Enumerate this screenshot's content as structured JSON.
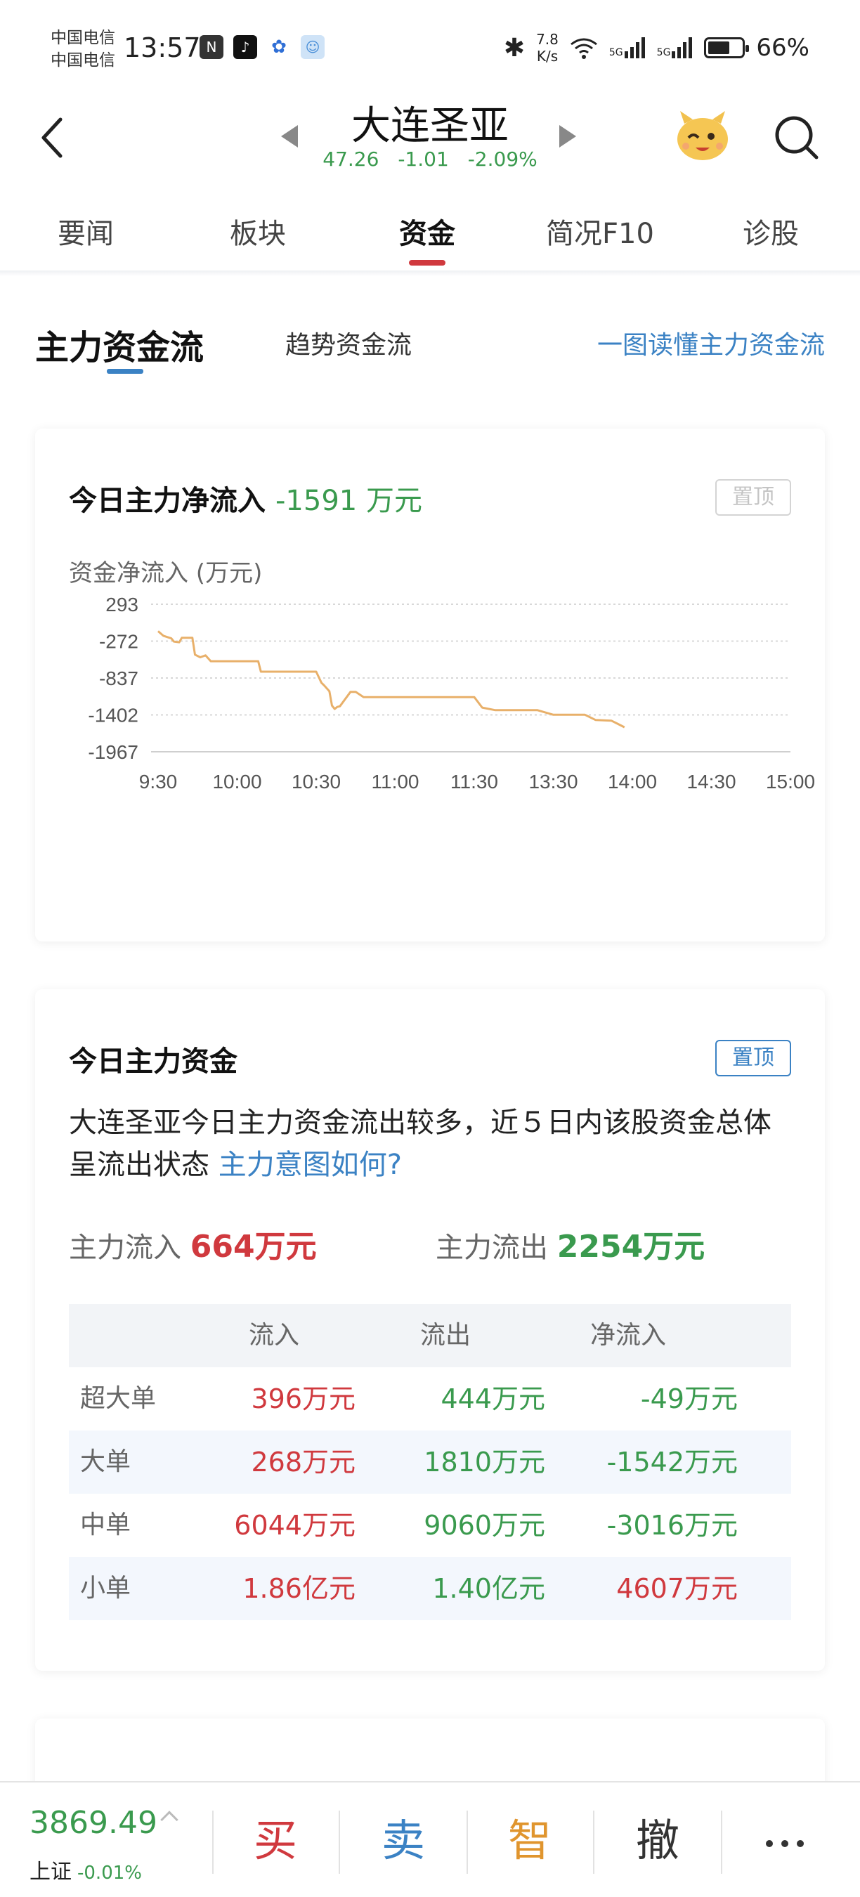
{
  "status_bar": {
    "carrier_1": "中国电信",
    "carrier_2": "中国电信",
    "time": "13:57",
    "net_speed_value": "7.8",
    "net_speed_unit": "K/s",
    "signal_label_1": "5G",
    "signal_label_2": "5G",
    "battery_percent": "66%",
    "battery_level": 0.66
  },
  "header": {
    "stock_name": "大连圣亚",
    "price": "47.26",
    "change": "-1.01",
    "change_pct": "-2.09%"
  },
  "tabs": [
    "要闻",
    "板块",
    "资金",
    "简况F10",
    "诊股"
  ],
  "active_tab": "资金",
  "subtabs": {
    "main": "主力资金流",
    "trend": "趋势资金流",
    "link": "一图读懂主力资金流"
  },
  "net_inflow_card": {
    "title": "今日主力净流入",
    "value": "-1591 万元",
    "pin_label": "置顶",
    "unit_label": "资金净流入 (万元)"
  },
  "chart_data": {
    "type": "line",
    "title": "今日主力净流入",
    "ylabel": "资金净流入 (万元)",
    "xlabel": "",
    "y_ticks": [
      "293",
      "-272",
      "-837",
      "-1402",
      "-1967"
    ],
    "x_ticks": [
      "9:30",
      "10:00",
      "10:30",
      "11:00",
      "11:30",
      "13:30",
      "14:00",
      "14:30",
      "15:00"
    ],
    "ylim": [
      -1967,
      293
    ],
    "grid": true,
    "line_color": "#e8b06a",
    "series": [
      {
        "points": [
          [
            0,
            -120
          ],
          [
            2,
            -190
          ],
          [
            5,
            -230
          ],
          [
            6,
            -280
          ],
          [
            8,
            -290
          ],
          [
            9,
            -220
          ],
          [
            13,
            -220
          ],
          [
            14,
            -480
          ],
          [
            16,
            -520
          ],
          [
            18,
            -490
          ],
          [
            20,
            -580
          ],
          [
            38,
            -580
          ],
          [
            39,
            -740
          ],
          [
            60,
            -740
          ],
          [
            62,
            -910
          ],
          [
            63,
            -950
          ],
          [
            65,
            -1040
          ],
          [
            66,
            -1260
          ],
          [
            67,
            -1310
          ],
          [
            68,
            -1280
          ],
          [
            69,
            -1270
          ],
          [
            73,
            -1050
          ],
          [
            75,
            -1050
          ],
          [
            78,
            -1130
          ],
          [
            90,
            -1130
          ],
          [
            120,
            -1130
          ],
          [
            123,
            -1290
          ],
          [
            128,
            -1330
          ],
          [
            144,
            -1330
          ],
          [
            150,
            -1400
          ],
          [
            162,
            -1400
          ],
          [
            166,
            -1480
          ],
          [
            172,
            -1490
          ],
          [
            174,
            -1530
          ],
          [
            177,
            -1591
          ]
        ]
      }
    ]
  },
  "capital_card": {
    "title": "今日主力资金",
    "pin_label": "置顶",
    "summary": "大连圣亚今日主力资金流出较多，近５日内该股资金总体呈流出状态",
    "summary_link": "主力意图如何?",
    "inflow_label": "主力流入",
    "inflow_value": "664万元",
    "outflow_label": "主力流出",
    "outflow_value": "2254万元",
    "table": {
      "headers": [
        "",
        "流入",
        "流出",
        "净流入"
      ],
      "rows": [
        {
          "type": "超大单",
          "in": "396万元",
          "out": "444万元",
          "net": "-49万元",
          "net_color": "#3a9a4e"
        },
        {
          "type": "大单",
          "in": "268万元",
          "out": "1810万元",
          "net": "-1542万元",
          "net_color": "#3a9a4e"
        },
        {
          "type": "中单",
          "in": "6044万元",
          "out": "9060万元",
          "net": "-3016万元",
          "net_color": "#3a9a4e"
        },
        {
          "type": "小单",
          "in": "1.86亿元",
          "out": "1.40亿元",
          "net": "4607万元",
          "net_color": "#d0393e"
        }
      ]
    }
  },
  "bottom_bar": {
    "index_value": "3869.49",
    "index_name": "上证",
    "index_change": "-0.01%",
    "buy": "买",
    "sell": "卖",
    "smart": "智",
    "cancel": "撤"
  },
  "colors": {
    "up_red": "#d0393e",
    "down_green": "#3a9a4e",
    "accent_blue": "#3b82c4",
    "chart_line": "#e8b06a"
  }
}
